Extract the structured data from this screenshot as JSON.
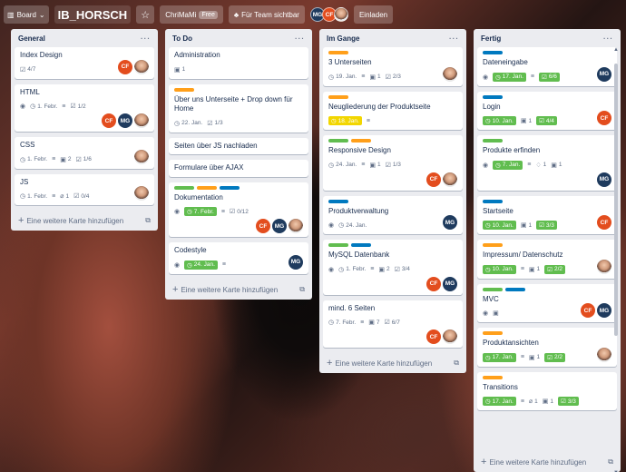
{
  "header": {
    "board_label": "Board",
    "board_title": "IB_HORSCH",
    "team_name": "ChriMaMi",
    "team_plan": "Free",
    "visibility": "Für Team sichtbar",
    "invite": "Einladen",
    "members": [
      "MG",
      "CF"
    ]
  },
  "lists": [
    {
      "title": "General",
      "menu": "···",
      "add": "Eine weitere Karte hinzufügen",
      "cards": [
        {
          "title": "Index Design",
          "check": "4/7",
          "members": [
            "CF",
            "photo"
          ]
        },
        {
          "title": "HTML",
          "due": "1. Febr.",
          "check": "1/2",
          "members": [
            "CF",
            "MG",
            "photo"
          ]
        },
        {
          "title": "CSS",
          "due": "1. Febr.",
          "attach": "2",
          "check": "1/6",
          "members": [
            "photo"
          ]
        },
        {
          "title": "JS",
          "due": "1. Febr.",
          "clip": "1",
          "check": "0/4",
          "members": [
            "photo"
          ]
        }
      ]
    },
    {
      "title": "To Do",
      "menu": "···",
      "add": "Eine weitere Karte hinzufügen",
      "cards": [
        {
          "title": "Administration",
          "attach": "1"
        },
        {
          "title": "Über uns Unterseite + Drop down für Home",
          "due": "22. Jan.",
          "check": "1/3"
        },
        {
          "title": "Seiten über JS nachladen"
        },
        {
          "title": "Formulare über AJAX"
        },
        {
          "title": "Dokumentation",
          "due": "7. Febr.",
          "check": "0/12",
          "members": [
            "CF",
            "MG",
            "photo"
          ]
        },
        {
          "title": "Codestyle",
          "due": "24. Jan.",
          "members": [
            "MG"
          ]
        }
      ]
    },
    {
      "title": "Im Gange",
      "menu": "···",
      "add": "Eine weitere Karte hinzufügen",
      "cards": [
        {
          "title": "3 Unterseiten",
          "due": "19. Jan.",
          "attach": "1",
          "check": "2/3",
          "members": [
            "photo"
          ]
        },
        {
          "title": "Neugliederung der Produktseite",
          "due": "18. Jan."
        },
        {
          "title": "Responsive Design",
          "due": "24. Jan.",
          "attach": "1",
          "check": "1/3",
          "members": [
            "CF",
            "photo"
          ]
        },
        {
          "title": "Produktverwaltung",
          "due": "24. Jan.",
          "members": [
            "MG"
          ]
        },
        {
          "title": "MySQL Datenbank",
          "due": "1. Febr.",
          "attach": "2",
          "check": "3/4",
          "members": [
            "CF",
            "MG"
          ]
        },
        {
          "title": "mind. 6 Seiten",
          "due": "7. Febr.",
          "attach": "7",
          "check": "6/7",
          "members": [
            "CF",
            "photo"
          ]
        }
      ]
    },
    {
      "title": "Fertig",
      "menu": "···",
      "add": "Eine weitere Karte hinzufügen",
      "cards": [
        {
          "title": "Dateneingabe",
          "due": "17. Jan.",
          "check": "6/6",
          "members": [
            "MG"
          ]
        },
        {
          "title": "Login",
          "due": "10. Jan.",
          "attach": "1",
          "check": "4/4",
          "members": [
            "CF"
          ]
        },
        {
          "title": "Produkte erfinden",
          "due": "7. Jan.",
          "comments": "1",
          "attach": "1",
          "members": [
            "MG"
          ]
        },
        {
          "title": "Startseite",
          "due": "10. Jan.",
          "attach": "1",
          "check": "3/3",
          "members": [
            "CF"
          ]
        },
        {
          "title": "Impressum/ Datenschutz",
          "due": "10. Jan.",
          "attach": "1",
          "check": "2/2",
          "members": [
            "photo"
          ]
        },
        {
          "title": "MVC",
          "attach": "",
          "members": [
            "CF",
            "MG"
          ]
        },
        {
          "title": "Produktansichten",
          "due": "17. Jan.",
          "attach": "1",
          "check": "2/2",
          "members": [
            "photo"
          ]
        },
        {
          "title": "Transitions",
          "due": "17. Jan.",
          "clip": "1",
          "attach": "1",
          "check": "3/3"
        }
      ]
    }
  ],
  "colors": {
    "due_green": "#61bd4f",
    "due_yellow": "#f2d600",
    "label_orange": "#ff9f1a",
    "label_green": "#61bd4f",
    "label_blue": "#0079bf",
    "mg": "#1f3b5e",
    "cf": "#e34d1e"
  }
}
